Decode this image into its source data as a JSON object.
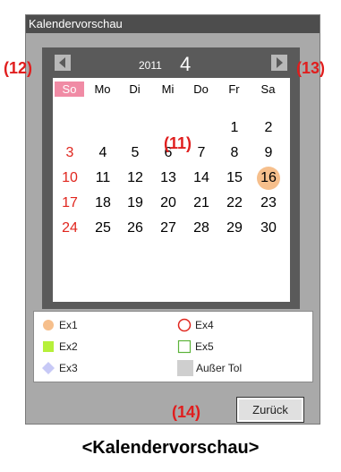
{
  "window": {
    "title": "Kalendervorschau"
  },
  "calendar": {
    "year": "2011",
    "month": "4",
    "weekdays": [
      "So",
      "Mo",
      "Di",
      "Mi",
      "Do",
      "Fr",
      "Sa"
    ],
    "weeks": [
      [
        "",
        "",
        "",
        "",
        "",
        "1",
        "2"
      ],
      [
        "3",
        "4",
        "5",
        "6",
        "7",
        "8",
        "9"
      ],
      [
        "10",
        "11",
        "12",
        "13",
        "14",
        "15",
        "16"
      ],
      [
        "17",
        "18",
        "19",
        "20",
        "21",
        "22",
        "23"
      ],
      [
        "24",
        "25",
        "26",
        "27",
        "28",
        "29",
        "30"
      ]
    ],
    "highlighted_day": "16"
  },
  "legend": {
    "ex1": "Ex1",
    "ex2": "Ex2",
    "ex3": "Ex3",
    "ex4": "Ex4",
    "ex5": "Ex5",
    "outside": "Außer Tol"
  },
  "buttons": {
    "back": "Zurück"
  },
  "callouts": {
    "c11": "(11)",
    "c12": "(12)",
    "c13": "(13)",
    "c14": "(14)"
  },
  "caption": "<Kalendervorschau>",
  "colors": {
    "sunday": "#e0261e",
    "today": "#f6bf8c",
    "ex2": "#b6f03a",
    "ex3": "#c7c9f6",
    "ex4": "#e0261e",
    "ex5": "#5db33a",
    "outside": "#cfcfcf"
  }
}
